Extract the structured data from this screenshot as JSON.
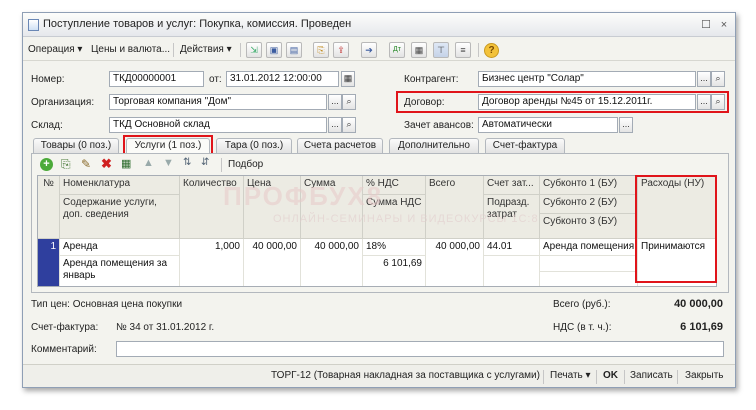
{
  "window": {
    "title": "Поступление товаров и услуг: Покупка, комиссия. Проведен",
    "controls": [
      "☐",
      "×"
    ]
  },
  "toolbar": {
    "operation": "Операция",
    "prices": "Цены и валюта...",
    "actions": "Действия",
    "selection": "Подбор"
  },
  "header": {
    "number_label": "Номер:",
    "number_value": "ТКД00000001",
    "from_label": "от:",
    "date_value": "31.01.2012 12:00:00",
    "org_label": "Организация:",
    "org_value": "Торговая компания \"Дом\"",
    "warehouse_label": "Склад:",
    "warehouse_value": "ТКД Основной склад",
    "counterparty_label": "Контрагент:",
    "counterparty_value": "Бизнес центр \"Солар\"",
    "contract_label": "Договор:",
    "contract_value": "Договор аренды №45 от 15.12.2011г.",
    "advances_label": "Зачет авансов:",
    "advances_value": "Автоматически"
  },
  "tabs": [
    {
      "label": "Товары (0 поз.)"
    },
    {
      "label": "Услуги (1 поз.)"
    },
    {
      "label": "Тара (0 поз.)"
    },
    {
      "label": "Счета расчетов"
    },
    {
      "label": "Дополнительно"
    },
    {
      "label": "Счет-фактура"
    }
  ],
  "table": {
    "headers": {
      "n": "№",
      "nomenclature": "Номенклатура",
      "content": "Содержание услуги, доп. сведения",
      "quantity": "Количество",
      "price": "Цена",
      "sum": "Сумма",
      "vat_rate": "% НДС",
      "vat_sum": "Сумма НДС",
      "total": "Всего",
      "cost_account": "Счет зат...",
      "subdivision": "Подразд. затрат",
      "subconto1": "Субконто 1 (БУ)",
      "subconto2": "Субконто 2 (БУ)",
      "subconto3": "Субконто 3 (БУ)",
      "expenses": "Расходы (НУ)"
    },
    "row": {
      "n": "1",
      "nomenclature": "Аренда",
      "content": "Аренда помещения за январь",
      "quantity": "1,000",
      "price": "40 000,00",
      "sum": "40 000,00",
      "vat_rate": "18%",
      "vat_sum": "6 101,69",
      "total": "40 000,00",
      "cost_account": "44.01",
      "subconto1": "Аренда помещения",
      "expenses": "Принимаются"
    }
  },
  "footer": {
    "price_type": "Тип цен: Основная цена покупки",
    "total_label": "Всего (руб.):",
    "total_value": "40 000,00",
    "invoice_label": "Счет-фактура:",
    "invoice_value": "№ 34 от 31.01.2012 г.",
    "vat_label": "НДС (в т. ч.):",
    "vat_value": "6 101,69",
    "comment_label": "Комментарий:"
  },
  "bottom": {
    "torg": "ТОРГ-12 (Товарная накладная за поставщика с услугами)",
    "print": "Печать",
    "ok": "OK",
    "save": "Записать",
    "close": "Закрыть"
  },
  "watermark": {
    "main": "ПРОФБУХ8",
    "sub": "ОНЛАЙН-СЕМИНАРЫ И ВИДЕОКУРСЫ 1С:8"
  },
  "colors": {
    "highlight": "#e0141a",
    "selected_row": "#2f3f9e"
  }
}
